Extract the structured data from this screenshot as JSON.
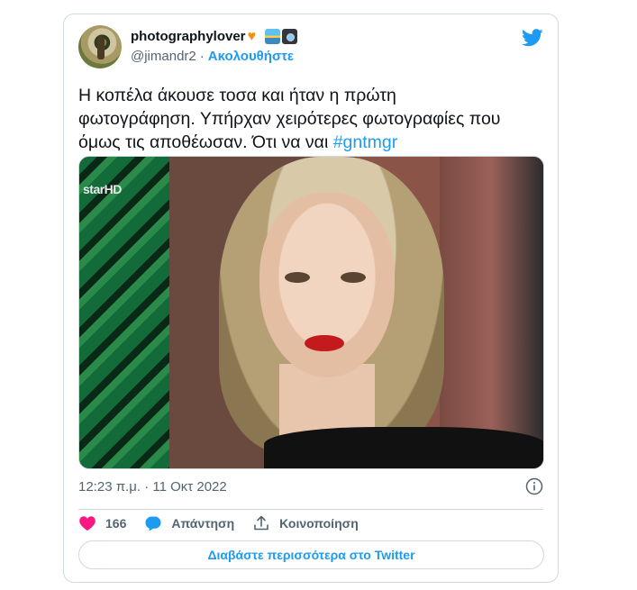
{
  "tweet": {
    "author": {
      "display_name": "photographylover",
      "name_emojis": [
        "orange-heart",
        "sunrise",
        "camera"
      ],
      "handle": "@jimandr2",
      "separator": "·",
      "follow_label": "Ακολουθήστε"
    },
    "text": "Η κοπέλα άκουσε τοσα και ήταν η πρώτη\nφωτογράφηση. Υπήρχαν χειρότερες φωτογραφίες που\nόμως τις αποθέωσαν. Ότι να ναι ",
    "hashtag": "#gntmgr",
    "media": {
      "overlay_logo": "starHD"
    },
    "timestamp": "12:23 π.μ. · 11 Οκτ 2022",
    "actions": {
      "like_count": "166",
      "reply_label": "Απάντηση",
      "share_label": "Κοινοποίηση"
    },
    "read_more_label": "Διαβάστε περισσότερα στο Twitter"
  },
  "colors": {
    "accent": "#1d9bf0",
    "like": "#f91880",
    "secondary_text": "#536471",
    "border": "#cfd9de"
  },
  "icons": [
    "twitter-bird-icon",
    "info-icon",
    "heart-icon",
    "reply-bubble-icon",
    "share-icon"
  ]
}
